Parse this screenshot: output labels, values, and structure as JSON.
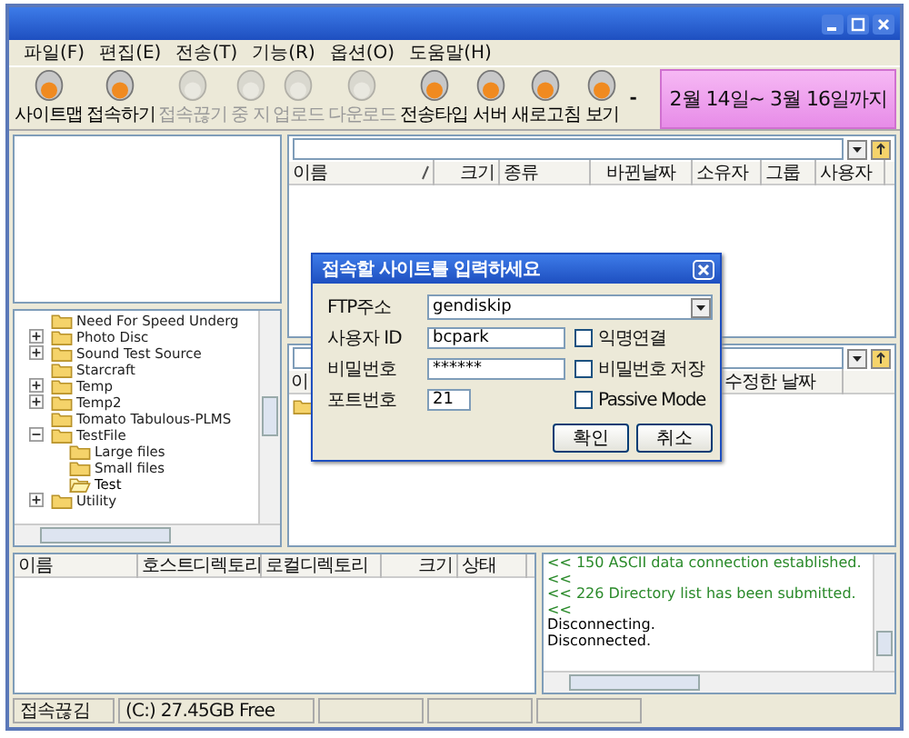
{
  "menu": [
    "파일(F)",
    "편집(E)",
    "전송(T)",
    "기능(R)",
    "옵션(O)",
    "도움말(H)"
  ],
  "toolbar": [
    {
      "label": "사이트맵",
      "disabled": false
    },
    {
      "label": "접속하기",
      "disabled": false
    },
    {
      "label": "접속끊기",
      "disabled": true
    },
    {
      "label": "중 지",
      "disabled": true
    },
    {
      "label": "업로드",
      "disabled": true
    },
    {
      "label": "다운로드",
      "disabled": true
    },
    {
      "label": "전송타입",
      "disabled": false
    },
    {
      "label": "서버",
      "disabled": false
    },
    {
      "label": "새로고침",
      "disabled": false
    },
    {
      "label": "보기",
      "disabled": false
    }
  ],
  "toolbar_separator": "-",
  "banner": "2월 14일~ 3월 16일까지",
  "tree": [
    {
      "name": "Need For Speed Underg",
      "kind": "leaf"
    },
    {
      "name": "Photo Disc",
      "kind": "collapsed"
    },
    {
      "name": "Sound Test Source",
      "kind": "collapsed"
    },
    {
      "name": "Starcraft",
      "kind": "leaf"
    },
    {
      "name": "Temp",
      "kind": "collapsed"
    },
    {
      "name": "Temp2",
      "kind": "collapsed"
    },
    {
      "name": "Tomato Tabulous-PLMS",
      "kind": "leaf"
    },
    {
      "name": "TestFile",
      "kind": "expanded",
      "children": [
        {
          "name": "Large files",
          "selected": false
        },
        {
          "name": "Small files",
          "selected": false
        },
        {
          "name": "Test",
          "selected": true
        }
      ]
    },
    {
      "name": "Utility",
      "kind": "collapsed"
    }
  ],
  "remote_columns": [
    "이름",
    "크기",
    "종류",
    "바뀐날짜",
    "소유자",
    "그룹",
    "사용자"
  ],
  "local_columns": [
    "이",
    "수정한 날짜"
  ],
  "transfer_columns": [
    "이름",
    "호스트디렉토리",
    "로컬디렉토리",
    "크기",
    "상태"
  ],
  "log": [
    {
      "text": "<< 150 ASCII data connection established.",
      "kind": "server"
    },
    {
      "text": "<<",
      "kind": "server"
    },
    {
      "text": "<< 226 Directory list has been submitted.",
      "kind": "server"
    },
    {
      "text": "<<",
      "kind": "server"
    },
    {
      "text": "Disconnecting.",
      "kind": "client"
    },
    {
      "text": "Disconnected.",
      "kind": "client"
    }
  ],
  "status_bar": [
    "접속끊김",
    "(C:) 27.45GB Free"
  ],
  "dialog": {
    "title": "접속할 사이트를 입력하세요",
    "fields": [
      {
        "label": "FTP주소",
        "value": "gendiskip",
        "kind": "combo"
      },
      {
        "label": "사용자 ID",
        "value": "bcpark",
        "kind": "text"
      },
      {
        "label": "비밀번호",
        "value": "******",
        "kind": "text"
      },
      {
        "label": "포트번호",
        "value": "21",
        "kind": "short"
      }
    ],
    "options": [
      {
        "label": "익명연결",
        "checked": false
      },
      {
        "label": "비밀번호 저장",
        "checked": false
      },
      {
        "label": "Passive Mode",
        "checked": false
      }
    ],
    "buttons": [
      "확인",
      "취소"
    ]
  }
}
